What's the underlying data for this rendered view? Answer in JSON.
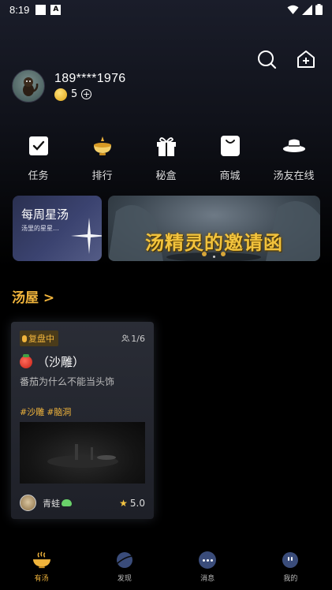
{
  "status_bar": {
    "time": "8:19"
  },
  "profile": {
    "phone": "189****1976",
    "coins": "5"
  },
  "shortcuts": [
    {
      "label": "任务",
      "icon": "task-check-icon"
    },
    {
      "label": "排行",
      "icon": "trophy-bowl-icon"
    },
    {
      "label": "秘盒",
      "icon": "gift-box-icon"
    },
    {
      "label": "商城",
      "icon": "shopping-bag-icon"
    },
    {
      "label": "汤友在线",
      "icon": "hat-icon"
    }
  ],
  "banners": {
    "small_title": "每周星汤",
    "small_sub": "汤里的星星…",
    "large_title": "汤精灵的邀请函"
  },
  "section": {
    "title": "汤屋 >"
  },
  "room": {
    "status": "复盘中",
    "people": "1/6",
    "title": "（沙雕）",
    "desc": "番茄为什么不能当头饰",
    "tags": [
      "#沙雕",
      "#脑洞"
    ],
    "host": "青蛙",
    "rating": "5.0"
  },
  "tabs": [
    {
      "label": "有汤",
      "active": true
    },
    {
      "label": "发现",
      "active": false
    },
    {
      "label": "消息",
      "active": false
    },
    {
      "label": "我的",
      "active": false
    }
  ],
  "colors": {
    "accent": "#f0b43c",
    "background": "#000000"
  }
}
